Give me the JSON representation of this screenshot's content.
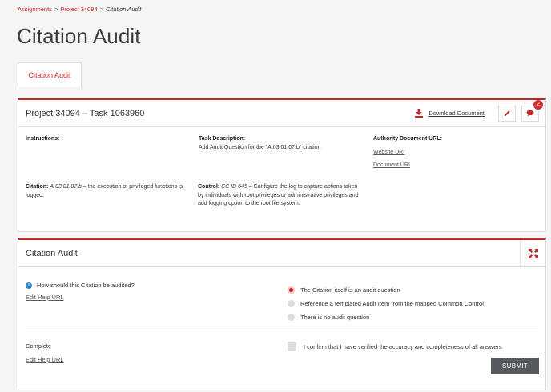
{
  "breadcrumb": {
    "items": [
      "Assignments",
      "Project 34094"
    ],
    "separator": ">",
    "current": "Citation Audit"
  },
  "page_title": "Citation Audit",
  "tab": {
    "label": "Citation Audit"
  },
  "task_card": {
    "title": "Project 34094 – Task 1063960",
    "download_label": "Download Document",
    "comments_count": "2",
    "instructions_label": "Instructions:",
    "task_description_label": "Task Description:",
    "task_description_value": "Add Audit Question for the \"A.03.01.07.b\" citation",
    "authority_label": "Authority Document URL:",
    "website_link": "Website URI",
    "document_link": "Document URI",
    "citation_label": "Citation:",
    "citation_id": "A.03.01.07.b",
    "citation_text": " – the execution of privileged functions is logged.",
    "control_label": "Control:",
    "control_id": "CC ID 645",
    "control_text": " – Configure the log to capture actions taken by individuals with root privileges or administrative privileges and add logging option to the root file system."
  },
  "audit_card": {
    "title": "Citation Audit",
    "question": "How should this Citation be audited?",
    "edit_help_1": "Edit Help URL",
    "options": [
      {
        "label": "The Citation itself is an audit question",
        "selected": true
      },
      {
        "label": "Reference a templated Audit Item from the mapped Common Control",
        "selected": false
      },
      {
        "label": "There is no audit question",
        "selected": false
      }
    ],
    "complete_label": "Complete",
    "edit_help_2": "Edit Help URL",
    "confirm_label": "I confirm that I have verified the accuracy and completeness of all answers",
    "submit_label": "SUBMIT"
  },
  "colors": {
    "accent": "#c62828",
    "badge": "#d32f2f",
    "info": "#2f86c9",
    "submit_bg": "#555a5e"
  },
  "icons": {
    "download": "download-icon",
    "edit": "pencil-icon",
    "comments": "comment-icon",
    "expand": "expand-arrows-icon",
    "info": "info-icon"
  }
}
